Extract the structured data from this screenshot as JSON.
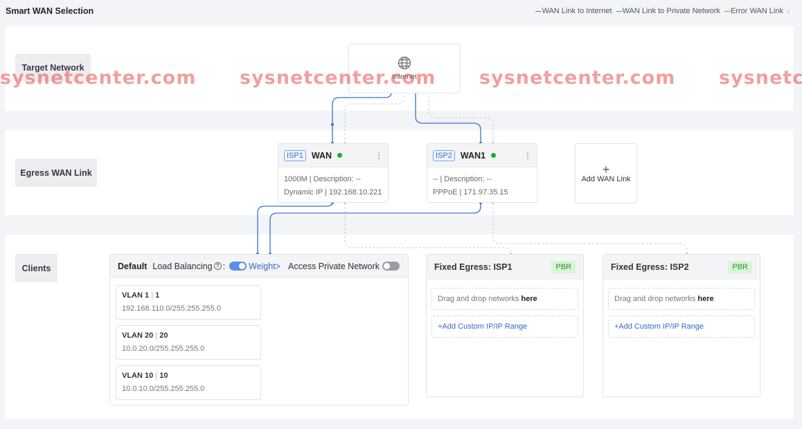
{
  "header": {
    "title": "Smart WAN Selection",
    "legend": [
      {
        "label": "WAN Link to Internet",
        "color": "#3a6fd0"
      },
      {
        "label": "WAN Link to Private Network",
        "color": "#2fa14a"
      },
      {
        "label": "Error WAN Link",
        "color": "#e55a4a"
      }
    ],
    "legend_more": "‹"
  },
  "rows": {
    "target": "Target Network",
    "egress": "Egress WAN Link",
    "clients": "Clients"
  },
  "internet": {
    "label": "Internet",
    "icon": "globe-icon"
  },
  "wans": [
    {
      "badge": "ISP1",
      "name": "WAN",
      "status": "online",
      "line1": "1000M | Description: --",
      "line2": "Dynamic IP | 192.168.10.221"
    },
    {
      "badge": "ISP2",
      "name": "WAN1",
      "status": "online",
      "line1": "-- | Description: --",
      "line2": "PPPoE | 171.97.35.15"
    }
  ],
  "add_wan": {
    "label": "Add WAN Link"
  },
  "clients": {
    "title": "Default",
    "load_balancing": "Load Balancing",
    "load_balancing_enabled": true,
    "weight": "Weight>",
    "access_private": "Access Private Network",
    "access_private_enabled": false,
    "vlans": [
      {
        "name": "VLAN 1",
        "id": "1",
        "network": "192.168.110.0/255.255.255.0"
      },
      {
        "name": "VLAN 20",
        "id": "20",
        "network": "10.0.20.0/255.255.255.0"
      },
      {
        "name": "VLAN 10",
        "id": "10",
        "network": "10.0.10.0/255.255.255.0"
      }
    ]
  },
  "fixed": [
    {
      "title": "Fixed Egress: ISP1",
      "badge": "PBR",
      "drop_text": "Drag and drop networks",
      "drop_here": "here",
      "add_link": "+Add Custom IP/IP Range"
    },
    {
      "title": "Fixed Egress: ISP2",
      "badge": "PBR",
      "drop_text": "Drag and drop networks",
      "drop_here": "here",
      "add_link": "+Add Custom IP/IP Range"
    }
  ],
  "watermark": "sysnetcenter.com"
}
